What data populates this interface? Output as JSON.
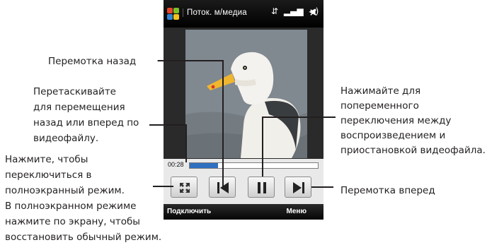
{
  "screen": {
    "app_title": "Поток. м/медиа",
    "status_icons": [
      "connection-icon",
      "signal-icon",
      "volume-icon"
    ],
    "close_icon": "close-icon",
    "time_elapsed": "00:28",
    "progress_fraction": 0.22,
    "buttons": [
      "fullscreen-button",
      "previous-button",
      "pause-button",
      "next-button"
    ],
    "soft_left": "Подключить",
    "soft_right": "Меню"
  },
  "callouts": {
    "rewind": "Перемотка назад",
    "drag_lines": [
      "Перетаскивайте",
      "для перемещения",
      "назад или вперед по",
      "видеофайлу."
    ],
    "fullscreen_lines": [
      "Нажмите, чтобы",
      "переключиться в",
      "полноэкранный режим.",
      "В полноэкранном режиме",
      "нажмите по экрану, чтобы",
      "восстановить обычный режим."
    ],
    "pause_lines": [
      "Нажимайте для",
      "попеременного",
      "переключения между",
      "воспроизведением и",
      "приостановкой видеофайла."
    ],
    "forward": "Перемотка вперед"
  },
  "colors": {
    "accent_progress": "#2f6fbf",
    "titlebar": "#000000",
    "callout_line": "#231f20"
  }
}
